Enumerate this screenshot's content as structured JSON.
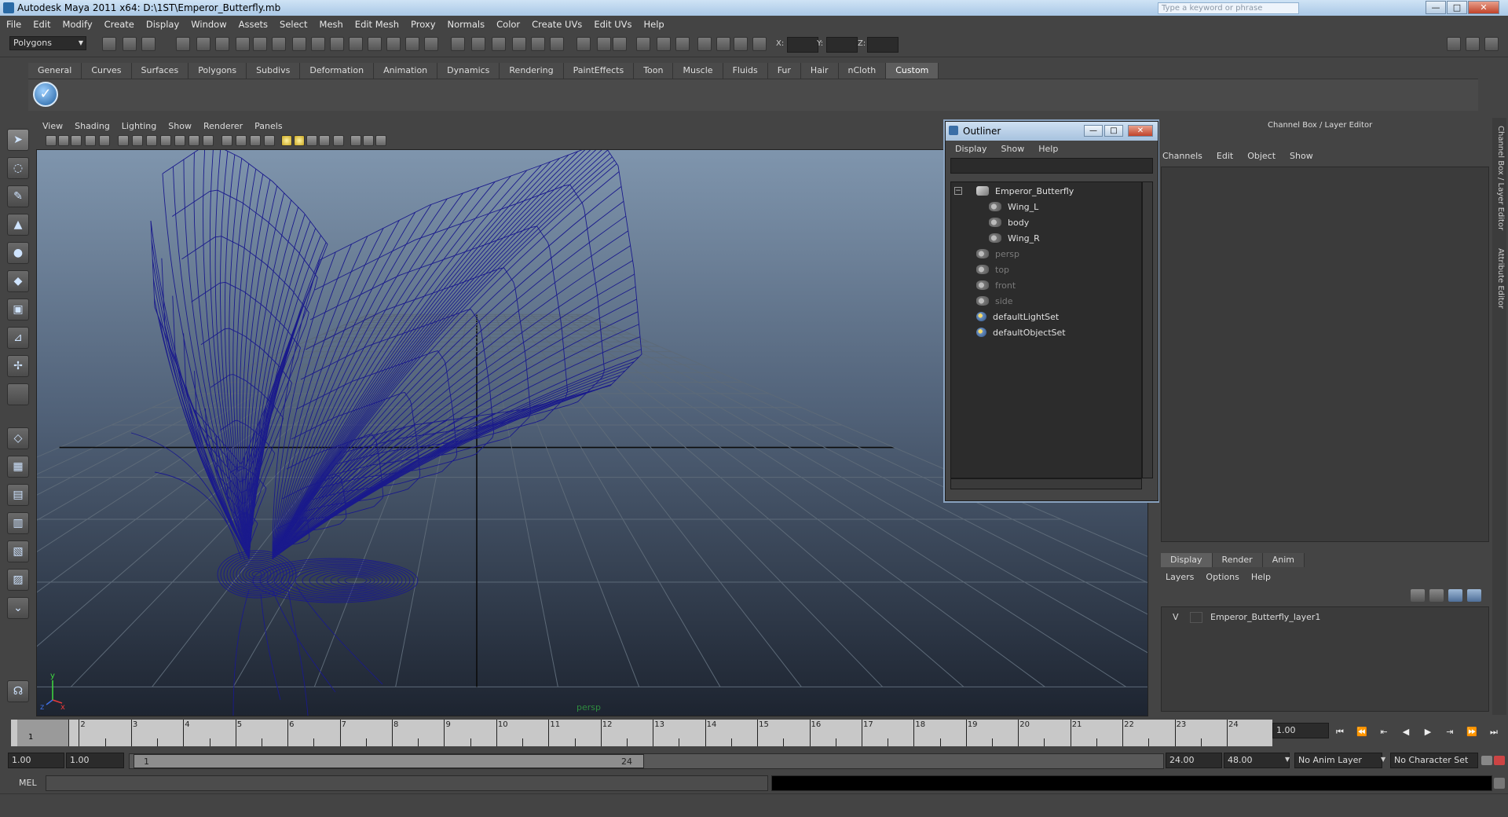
{
  "window": {
    "title": "Autodesk Maya 2011 x64: D:\\1ST\\Emperor_Butterfly.mb",
    "search_placeholder": "Type a keyword or phrase",
    "buttons": {
      "minimize": "—",
      "maximize": "□",
      "close": "✕"
    }
  },
  "menubar": [
    "File",
    "Edit",
    "Modify",
    "Create",
    "Display",
    "Window",
    "Assets",
    "Select",
    "Mesh",
    "Edit Mesh",
    "Proxy",
    "Normals",
    "Color",
    "Create UVs",
    "Edit UVs",
    "Help"
  ],
  "statusline": {
    "mode": "Polygons",
    "coords": {
      "x_label": "X:",
      "y_label": "Y:",
      "z_label": "Z:"
    }
  },
  "shelf": {
    "tabs": [
      "General",
      "Curves",
      "Surfaces",
      "Polygons",
      "Subdivs",
      "Deformation",
      "Animation",
      "Dynamics",
      "Rendering",
      "PaintEffects",
      "Toon",
      "Muscle",
      "Fluids",
      "Fur",
      "Hair",
      "nCloth",
      "Custom"
    ],
    "active_tab": "Custom",
    "icon": "check-circle-icon"
  },
  "viewport": {
    "menu": [
      "View",
      "Shading",
      "Lighting",
      "Show",
      "Renderer",
      "Panels"
    ],
    "camera_label": "persp",
    "axis": {
      "y": "y",
      "z": "z",
      "x": "x"
    },
    "wire_color": "#1a1a8c"
  },
  "outliner": {
    "title": "Outliner",
    "menu": [
      "Display",
      "Show",
      "Help"
    ],
    "items": [
      {
        "label": "Emperor_Butterfly",
        "icon": "mesh-group-icon",
        "dim": false
      },
      {
        "label": "Wing_L",
        "icon": "mesh-icon",
        "dim": false
      },
      {
        "label": "body",
        "icon": "mesh-icon",
        "dim": false
      },
      {
        "label": "Wing_R",
        "icon": "mesh-icon",
        "dim": false
      },
      {
        "label": "persp",
        "icon": "camera-icon",
        "dim": true
      },
      {
        "label": "top",
        "icon": "camera-icon",
        "dim": true
      },
      {
        "label": "front",
        "icon": "camera-icon",
        "dim": true
      },
      {
        "label": "side",
        "icon": "camera-icon",
        "dim": true
      },
      {
        "label": "defaultLightSet",
        "icon": "set-icon",
        "dim": false
      },
      {
        "label": "defaultObjectSet",
        "icon": "set-icon",
        "dim": false
      }
    ]
  },
  "channelbox": {
    "title": "Channel Box / Layer Editor",
    "menu": [
      "Channels",
      "Edit",
      "Object",
      "Show"
    ],
    "layer_tabs": [
      "Display",
      "Render",
      "Anim"
    ],
    "layer_menu": [
      "Layers",
      "Options",
      "Help"
    ],
    "layer": {
      "visibility": "V",
      "name": "Emperor_Butterfly_layer1"
    },
    "side_tabs": [
      "Channel Box / Layer Editor",
      "Attribute Editor"
    ]
  },
  "timeslider": {
    "ticks": [
      "1",
      "2",
      "3",
      "4",
      "5",
      "6",
      "7",
      "8",
      "9",
      "10",
      "11",
      "12",
      "13",
      "14",
      "15",
      "16",
      "17",
      "18",
      "19",
      "20",
      "21",
      "22",
      "23",
      "24"
    ],
    "current_frame": "1",
    "current_time": "1.00"
  },
  "range": {
    "start": "1.00",
    "playback_start": "1.00",
    "handle_start": "1",
    "handle_end": "24",
    "playback_end": "24.00",
    "end": "48.00",
    "anim_layer": "No Anim Layer",
    "char_set": "No Character Set"
  },
  "cmdline": {
    "label": "MEL"
  }
}
